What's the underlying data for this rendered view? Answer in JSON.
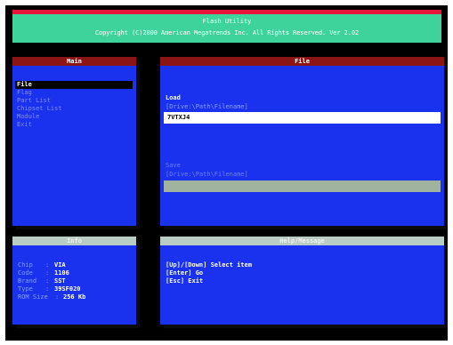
{
  "title": "Flash Utility",
  "copyright": "Copyright (C)2000 American Megatrends Inc. All Rights Reserved. Ver 2.02",
  "main": {
    "header": "Main",
    "items": [
      {
        "label": "File",
        "selected": true
      },
      {
        "label": "Flag"
      },
      {
        "label": "Part List"
      },
      {
        "label": "Chipset List"
      },
      {
        "label": "Module"
      },
      {
        "label": "Exit"
      }
    ]
  },
  "file": {
    "header": "File",
    "load_label": "Load",
    "load_path_hint": "[Drive:\\Path\\Filename]",
    "load_value": "7VTXJ4",
    "save_label": "Save",
    "save_path_hint": "[Drive:\\Path\\Filename]",
    "save_value": ""
  },
  "info": {
    "header": "Info",
    "rows": [
      {
        "key": "Chip",
        "value": "VIA"
      },
      {
        "key": "Code",
        "value": "1106"
      },
      {
        "key": "Brand",
        "value": "SST"
      },
      {
        "key": "Type",
        "value": "39SF020"
      },
      {
        "key": "ROM Size",
        "value": "256 Kb"
      }
    ]
  },
  "help": {
    "header": "Help/Message",
    "lines": [
      "[Up]/[Down] Select item",
      "[Enter] Go",
      "[Esc] Exit"
    ]
  },
  "colors": {
    "title_bar": "#3dd39b",
    "title_accent": "#e8163a",
    "panel": "#1a31ee",
    "header_red": "#8b1515",
    "header_gray": "#b9cdc5"
  }
}
